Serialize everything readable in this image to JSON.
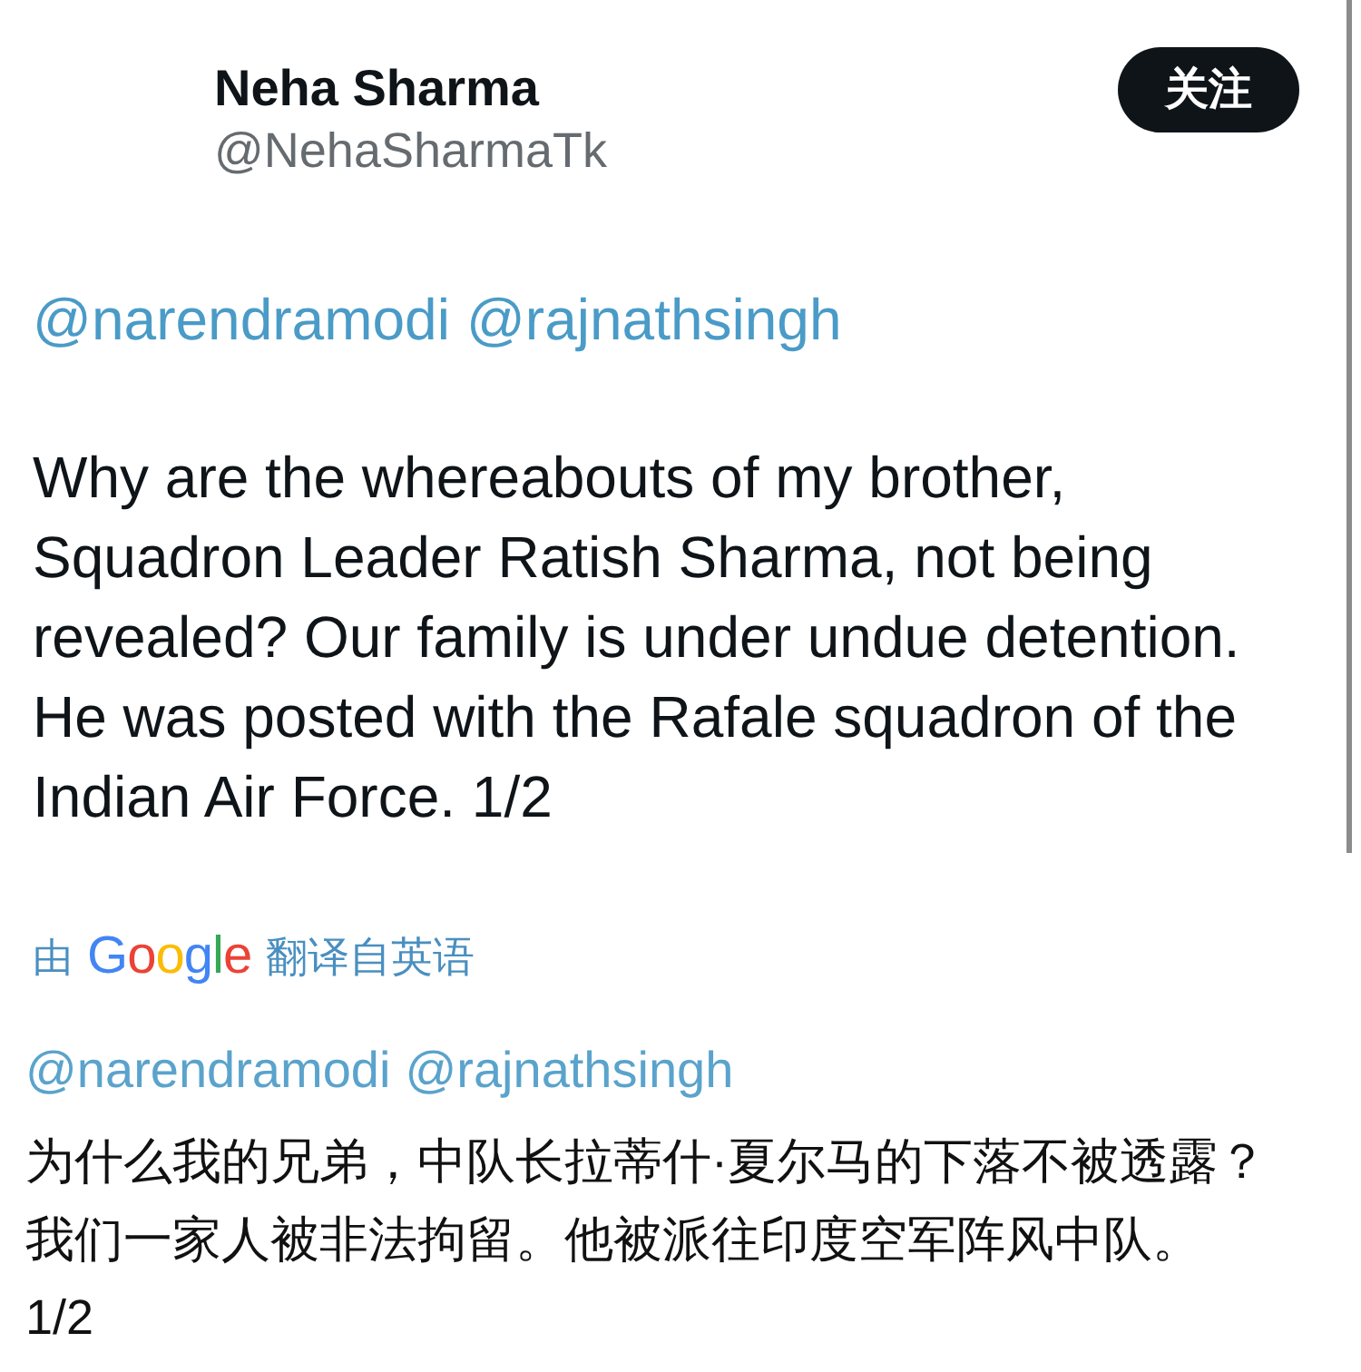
{
  "author": {
    "name": "Neha Sharma",
    "handle": "@NehaSharmaTk"
  },
  "follow_button": {
    "label": "关注"
  },
  "tweet": {
    "mentions": [
      "@narendramodi",
      "@rajnathsingh"
    ],
    "text": "Why are the whereabouts of my brother, Squadron Leader Ratish Sharma, not being revealed? Our family is under undue detention. He was posted with the Rafale squadron of the Indian Air Force. 1/2"
  },
  "translation": {
    "label_prefix": "由",
    "provider_logo": "Google",
    "label_suffix": "翻译自英语",
    "mentions": [
      "@narendramodi",
      "@rajnathsingh"
    ],
    "text": "为什么我的兄弟，中队长拉蒂什·夏尔马的下落不被透露？我们一家人被非法拘留。他被派往印度空军阵风中队。\n1/2"
  }
}
